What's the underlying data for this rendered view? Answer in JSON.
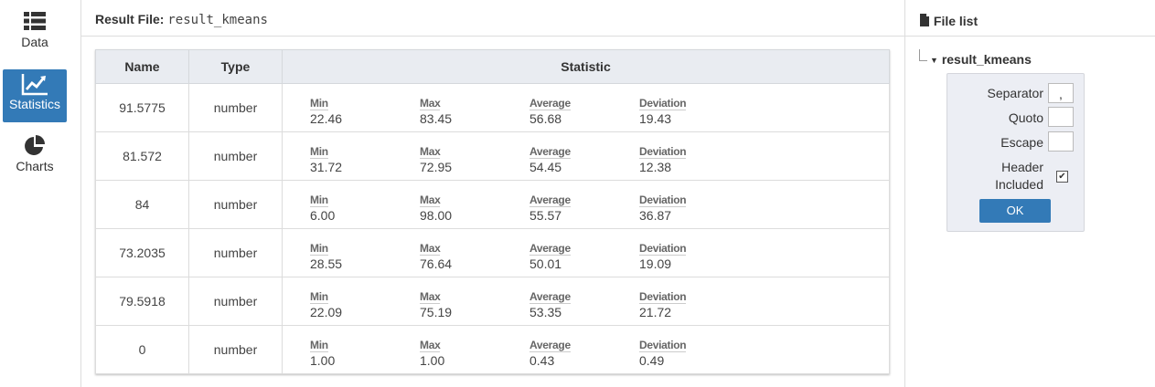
{
  "nav": {
    "items": [
      {
        "label": "Data",
        "icon": "list-icon"
      },
      {
        "label": "Statistics",
        "icon": "line-chart-icon",
        "active": true
      },
      {
        "label": "Charts",
        "icon": "pie-chart-icon"
      }
    ]
  },
  "result": {
    "prefix": "Result File:",
    "file": "result_kmeans"
  },
  "table": {
    "headers": [
      "Name",
      "Type",
      "Statistic"
    ],
    "stat_labels": [
      "Min",
      "Max",
      "Average",
      "Deviation"
    ],
    "rows": [
      {
        "name": "91.5775",
        "type": "number",
        "min": "22.46",
        "max": "83.45",
        "average": "56.68",
        "deviation": "19.43"
      },
      {
        "name": "81.572",
        "type": "number",
        "min": "31.72",
        "max": "72.95",
        "average": "54.45",
        "deviation": "12.38"
      },
      {
        "name": "84",
        "type": "number",
        "min": "6.00",
        "max": "98.00",
        "average": "55.57",
        "deviation": "36.87"
      },
      {
        "name": "73.2035",
        "type": "number",
        "min": "28.55",
        "max": "76.64",
        "average": "50.01",
        "deviation": "19.09"
      },
      {
        "name": "79.5918",
        "type": "number",
        "min": "22.09",
        "max": "75.19",
        "average": "53.35",
        "deviation": "21.72"
      },
      {
        "name": "0",
        "type": "number",
        "min": "1.00",
        "max": "1.00",
        "average": "0.43",
        "deviation": "0.49"
      }
    ]
  },
  "side": {
    "title": "File list",
    "file": "result_kmeans",
    "separator_label": "Separator",
    "separator_value": ",",
    "quote_label": "Quoto",
    "quote_value": "",
    "escape_label": "Escape",
    "escape_value": "",
    "header_label_1": "Header",
    "header_label_2": "Included",
    "header_checked": true,
    "ok_label": "OK"
  },
  "colors": {
    "accent": "#337ab7",
    "table_header": "#e9ecf1",
    "panel": "#eceef4"
  }
}
